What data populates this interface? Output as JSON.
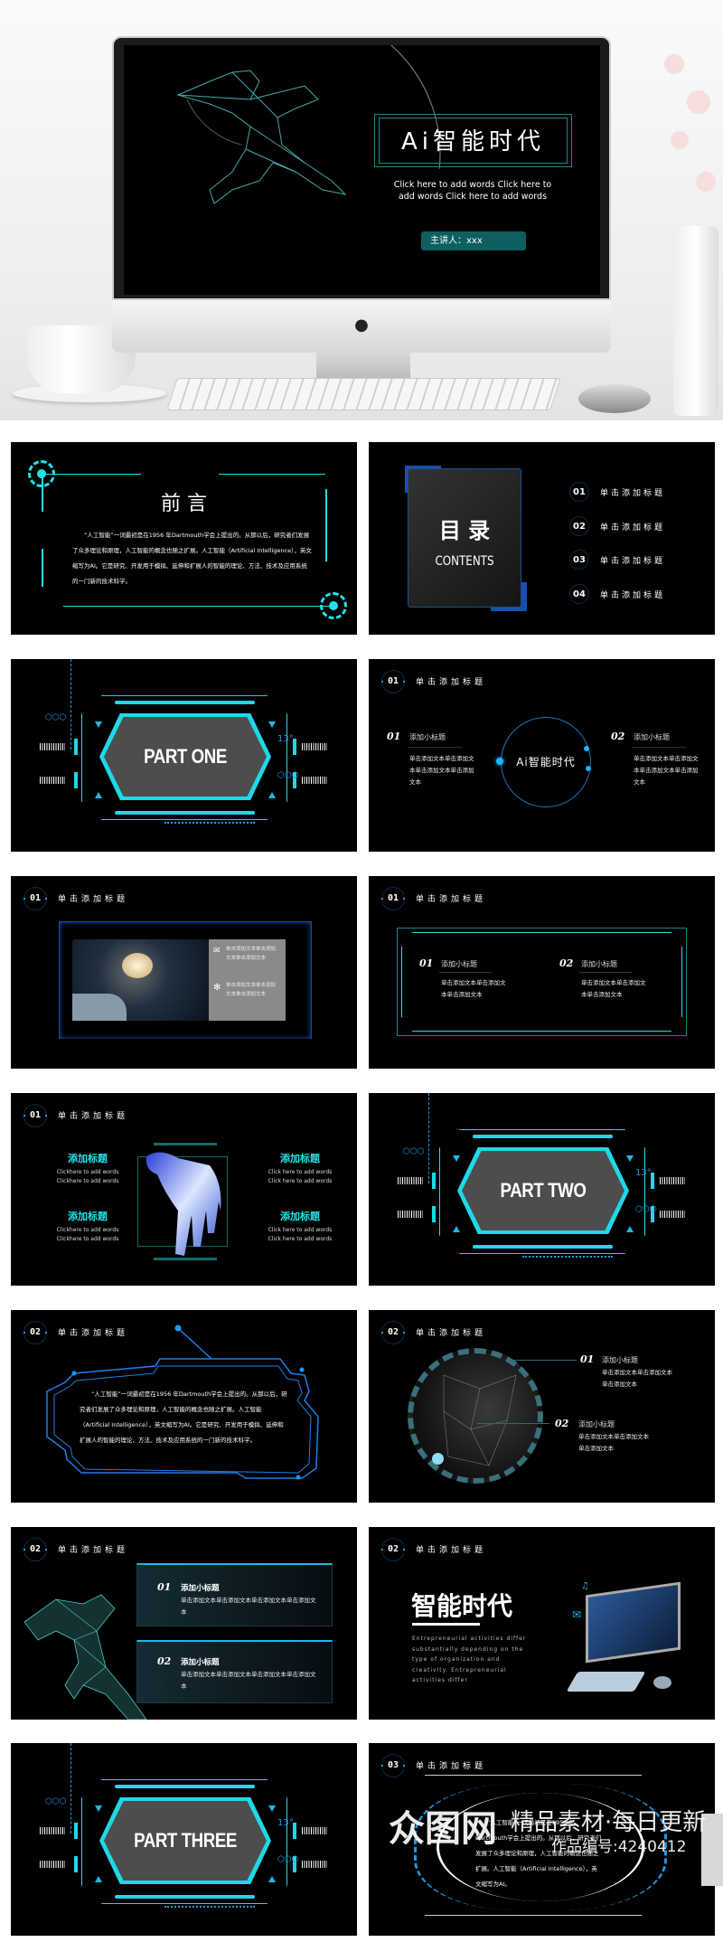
{
  "hero": {
    "title": "Ai智能时代",
    "subtitle": "Click here to add words Click here to add words Click here to add words",
    "presenter": "主讲人：xxx",
    "logo_icon": "apple-icon"
  },
  "colors": {
    "accent": "#1fe3e8",
    "blue": "#1e7ee8",
    "teal_pill": "#0e5f5f",
    "slide_bg": "#000000"
  },
  "preface": {
    "title": "前 言",
    "body": "“人工智能”一词最初是在1956 年Dartmouth学会上提出的。从那以后，研究者们发展了众多理论和原理，人工智能的概念也随之扩展。人工智能（Artificial Intelligence），英文缩写为AI。它是研究、开发用于模拟、延伸和扩展人的智能的理论、方法、技术及应用系统的一门新的技术科学。"
  },
  "contents": {
    "title": "目 录",
    "subtitle": "CONTENTS",
    "items": [
      {
        "num": "01",
        "label": "单击添加标题"
      },
      {
        "num": "02",
        "label": "单击添加标题"
      },
      {
        "num": "03",
        "label": "单击添加标题"
      },
      {
        "num": "04",
        "label": "单击添加标题"
      }
    ]
  },
  "part_one": {
    "title": "PART ONE",
    "deco_13": "13°"
  },
  "part_two": {
    "title": "PART TWO",
    "deco_13": "13°"
  },
  "part_three": {
    "title": "PART THREE",
    "deco_13": "13°"
  },
  "header_label": "单击添加标题",
  "circle_slide": {
    "num": "01",
    "center": "Ai智能时代",
    "items": [
      {
        "num": "01",
        "title": "添加小标题",
        "text": "单击添加文本单击添加文本单击添加文本单击添加文本"
      },
      {
        "num": "02",
        "title": "添加小标题",
        "text": "单击添加文本单击添加文本单击添加文本单击添加文本"
      }
    ]
  },
  "image_slide": {
    "num": "01",
    "items": [
      {
        "icon": "mail-icon",
        "text": "单击添加文本单击添加文本单击添加文本"
      },
      {
        "icon": "network-icon",
        "text": "单击添加文本单击添加文本单击添加文本"
      }
    ]
  },
  "frame_slide": {
    "num": "01",
    "items": [
      {
        "num": "01",
        "title": "添加小标题",
        "text": "单击添加文本单击添加文本单击添加文本"
      },
      {
        "num": "02",
        "title": "添加小标题",
        "text": "单击添加文本单击添加文本单击添加文本"
      }
    ]
  },
  "hand_slide": {
    "num": "01",
    "items": [
      {
        "title": "添加标题",
        "line1": "Clickhere to add words",
        "line2": "Clickhere to add words"
      },
      {
        "title": "添加标题",
        "line1": "Click here to add words",
        "line2": "Click here to add words"
      },
      {
        "title": "添加标题",
        "line1": "Clickhere to add words",
        "line2": "Clickhere to add words"
      },
      {
        "title": "添加标题",
        "line1": "Click here to add words",
        "line2": "Click here to add words"
      }
    ]
  },
  "text_slide": {
    "num": "02",
    "body": "“人工智能”一词最初是在1956 年Dartmouth学会上提出的。从那以后，研究者们发展了众多理论和原理，人工智能的概念也随之扩展。人工智能（Artificial Intelligence），英文缩写为AI。它是研究、开发用于模拟、延伸和扩展人的智能的理论、方法、技术及应用系统的一门新的技术科学。"
  },
  "sphere_slide": {
    "num": "02",
    "items": [
      {
        "num": "01",
        "title": "添加小标题",
        "text": "单击添加文本单击添加文本单击添加文本"
      },
      {
        "num": "02",
        "title": "添加小标题",
        "text": "单击添加文本单击添加文本单击添加文本"
      }
    ]
  },
  "runner_slide": {
    "num": "02",
    "items": [
      {
        "num": "01",
        "title": "添加小标题",
        "text": "单击添加文本单击添加文本单击添加文本单击添加文本"
      },
      {
        "num": "02",
        "title": "添加小标题",
        "text": "单击添加文本单击添加文本单击添加文本单击添加文本"
      }
    ]
  },
  "era_slide": {
    "num": "02",
    "title": "智能时代",
    "text": "Entrepreneurial activities differ substantially depending on the type of organization and creativity. Entrepreneurial activities differ"
  },
  "last_slide": {
    "num": "03",
    "body": "“人工智能”一词最初是在1956 年Dartmouth学会上提出的。从那以后，研究者们发展了众多理论和原理，人工智能的概念也随之扩展。人工智能（Artificial Intelligence），英文缩写为AI。"
  },
  "watermark": {
    "logo": "众图网",
    "slogan": "精品素材·每日更新",
    "id": "作品编号:4240412"
  }
}
